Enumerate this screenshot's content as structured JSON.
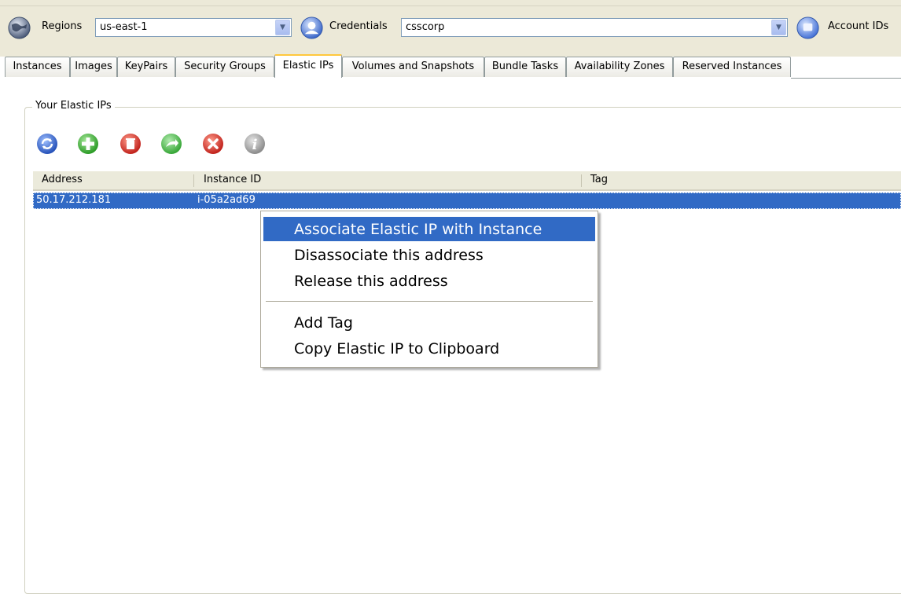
{
  "toolbar": {
    "regions_label": "Regions",
    "region_value": "us-east-1",
    "credentials_label": "Credentials",
    "credentials_value": "csscorp",
    "account_ids_label": "Account IDs"
  },
  "tabs": [
    {
      "label": "Instances"
    },
    {
      "label": "Images"
    },
    {
      "label": "KeyPairs"
    },
    {
      "label": "Security Groups"
    },
    {
      "label": "Elastic IPs",
      "active": true
    },
    {
      "label": "Volumes and Snapshots"
    },
    {
      "label": "Bundle Tasks"
    },
    {
      "label": "Availability Zones"
    },
    {
      "label": "Reserved Instances"
    }
  ],
  "panel": {
    "title": "Your Elastic IPs",
    "tool_icons": [
      "refresh-icon",
      "add-icon",
      "delete-icon",
      "associate-icon",
      "disassociate-icon",
      "info-icon"
    ]
  },
  "table": {
    "columns": [
      "Address",
      "Instance ID",
      "Tag"
    ],
    "rows": [
      {
        "address": "50.17.212.181",
        "instance_id": "i-05a2ad69",
        "tag": ""
      }
    ]
  },
  "context_menu": {
    "items": [
      {
        "label": "Associate Elastic IP with Instance",
        "highlighted": true
      },
      {
        "label": "Disassociate this address"
      },
      {
        "label": "Release this address"
      },
      {
        "label": "Add Tag"
      },
      {
        "label": "Copy Elastic IP to Clipboard"
      }
    ]
  },
  "colors": {
    "selection": "#316ac5",
    "window_bg": "#ece9d8",
    "active_tab_accent": "#ffc83c"
  }
}
